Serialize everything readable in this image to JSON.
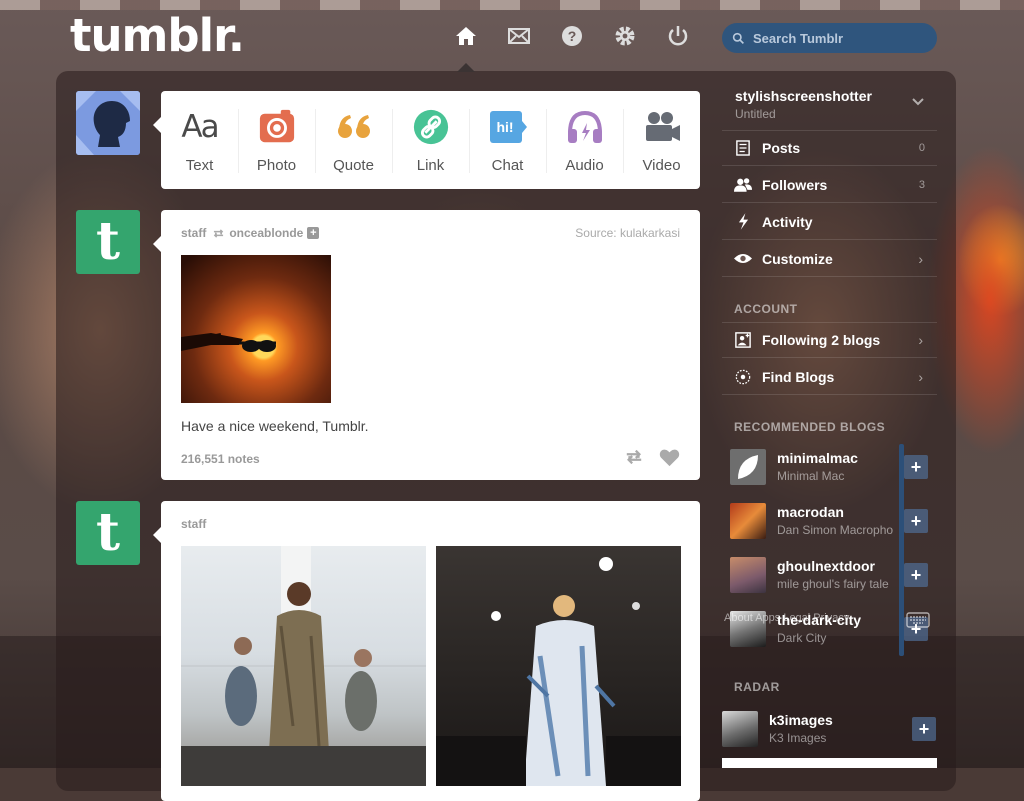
{
  "app": {
    "logo": "tumblr."
  },
  "header": {
    "nav": [
      "home-icon",
      "mail-icon",
      "help-icon",
      "settings-icon",
      "power-icon"
    ],
    "search_placeholder": "Search Tumblr"
  },
  "post_types": [
    {
      "label": "Text",
      "glyph": "Aa",
      "color": "#4a4a4a"
    },
    {
      "label": "Photo",
      "color": "#e36d4f"
    },
    {
      "label": "Quote",
      "glyph": "66",
      "color": "#e8a33d"
    },
    {
      "label": "Link",
      "color": "#48c395"
    },
    {
      "label": "Chat",
      "glyph": "hi!",
      "color": "#56a6e2"
    },
    {
      "label": "Audio",
      "color": "#a77dc2"
    },
    {
      "label": "Video",
      "color": "#666b74"
    }
  ],
  "posts": [
    {
      "author": "staff",
      "reblogged_from": "onceablonde",
      "source_label": "Source:",
      "source": "kulakarkasi",
      "caption": "Have a nice weekend, Tumblr.",
      "notes": "216,551 notes"
    },
    {
      "author": "staff"
    }
  ],
  "sidebar": {
    "blog_name": "stylishscreenshotter",
    "blog_title": "Untitled",
    "items": [
      {
        "label": "Posts",
        "count": "0"
      },
      {
        "label": "Followers",
        "count": "3"
      },
      {
        "label": "Activity"
      },
      {
        "label": "Customize"
      }
    ],
    "account_title": "ACCOUNT",
    "account_items": [
      {
        "label": "Following 2 blogs"
      },
      {
        "label": "Find Blogs"
      }
    ],
    "recommended_title": "RECOMMENDED BLOGS",
    "recommended": [
      {
        "name": "minimalmac",
        "title": "Minimal Mac"
      },
      {
        "name": "macrodan",
        "title": "Dan Simon Macropho"
      },
      {
        "name": "ghoulnextdoor",
        "title": "mile ghoul's fairy tale"
      },
      {
        "name": "the-dark-city",
        "title": "Dark City"
      }
    ],
    "footer_text": "About Apps Legal Privacy",
    "radar_title": "RADAR",
    "radar": [
      {
        "name": "k3images",
        "title": "K3 Images"
      }
    ]
  },
  "colors": {
    "tumblr_green": "#34a56e",
    "search_bg": "#2f557d",
    "accent_blue": "#2c4f78"
  }
}
